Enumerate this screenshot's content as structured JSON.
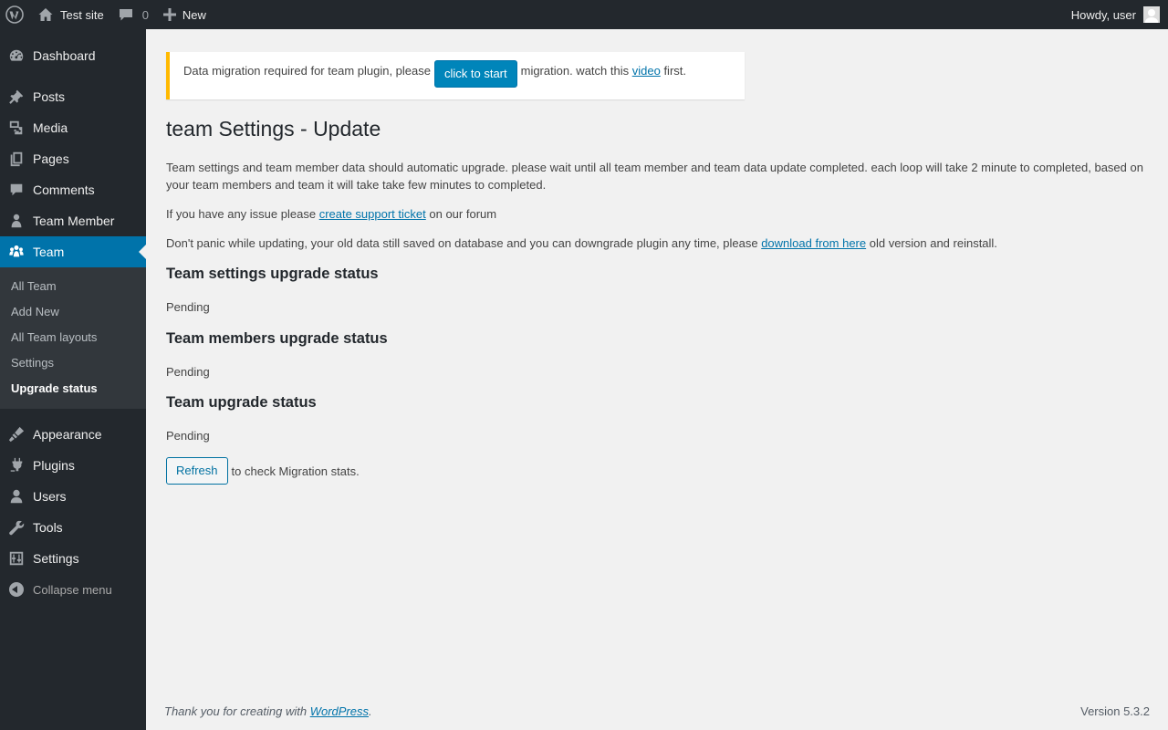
{
  "adminbar": {
    "site_name": "Test site",
    "comments_count": "0",
    "new_label": "New",
    "greeting": "Howdy, user"
  },
  "sidebar": {
    "items": [
      {
        "label": "Dashboard",
        "icon": "dashboard-icon"
      },
      {
        "label": "Posts",
        "icon": "pin-icon"
      },
      {
        "label": "Media",
        "icon": "media-icon"
      },
      {
        "label": "Pages",
        "icon": "pages-icon"
      },
      {
        "label": "Comments",
        "icon": "comment-icon"
      },
      {
        "label": "Team Member",
        "icon": "person-icon"
      },
      {
        "label": "Team",
        "icon": "groups-icon"
      },
      {
        "label": "Appearance",
        "icon": "brush-icon"
      },
      {
        "label": "Plugins",
        "icon": "plug-icon"
      },
      {
        "label": "Users",
        "icon": "user-icon"
      },
      {
        "label": "Tools",
        "icon": "wrench-icon"
      },
      {
        "label": "Settings",
        "icon": "sliders-icon"
      }
    ],
    "submenu": [
      "All Team",
      "Add New",
      "All Team layouts",
      "Settings",
      "Upgrade status"
    ],
    "collapse_label": "Collapse menu"
  },
  "notice": {
    "text_before": "Data migration required for team plugin, please",
    "button_label": "click to start",
    "text_after": "migration. watch this",
    "link_label": "video",
    "text_end": "first."
  },
  "main": {
    "title": "team Settings - Update",
    "intro": "Team settings and team member data should automatic upgrade. please wait until all team member and team data update completed. each loop will take 2 minute to completed, based on your team members and team it will take take few minutes to completed.",
    "issue_before": "If you have any issue please",
    "issue_link": "create support ticket",
    "issue_after": "on our forum",
    "panic_before": "Don't panic while updating, your old data still saved on database and you can downgrade plugin any time, please",
    "panic_link": "download from here",
    "panic_after": "old version and reinstall.",
    "sections": [
      {
        "heading": "Team settings upgrade status",
        "status": "Pending"
      },
      {
        "heading": "Team members upgrade status",
        "status": "Pending"
      },
      {
        "heading": "Team upgrade status",
        "status": "Pending"
      }
    ],
    "refresh_label": "Refresh",
    "refresh_after": "to check Migration stats."
  },
  "footer": {
    "thanks_before": "Thank you for creating with",
    "thanks_link": "WordPress",
    "thanks_after": ".",
    "version": "Version 5.3.2"
  },
  "colors": {
    "adminbar_bg": "#23282d",
    "accent": "#0073aa",
    "notice_warning": "#ffb900"
  }
}
